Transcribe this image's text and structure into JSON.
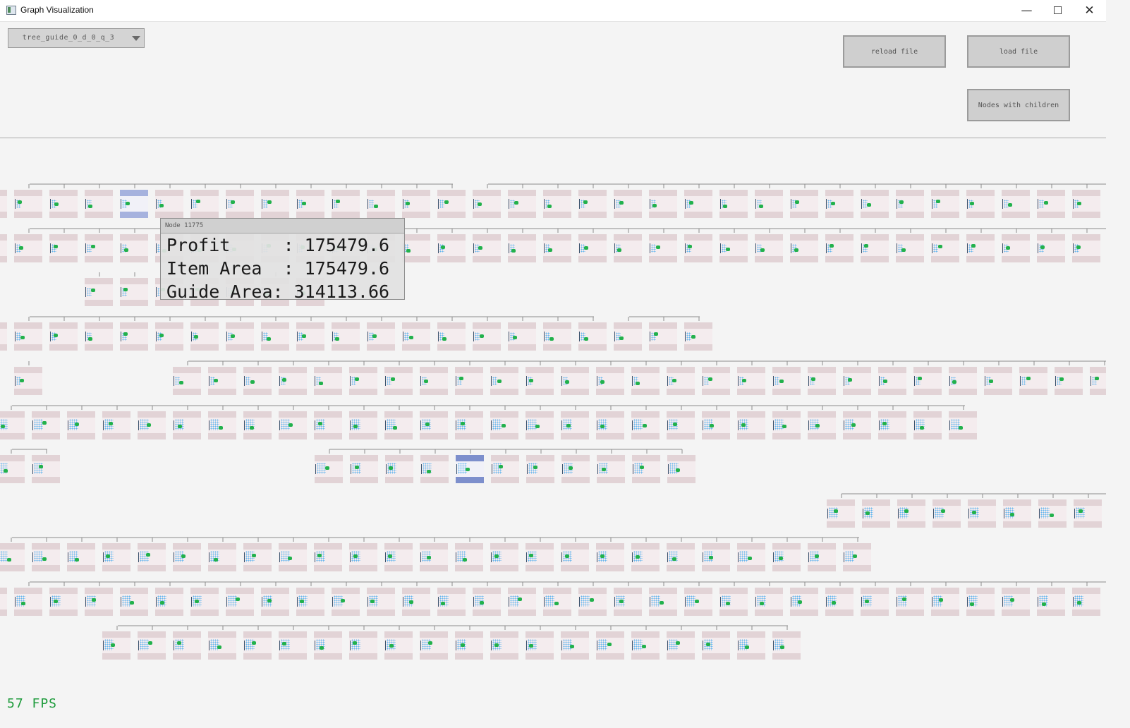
{
  "window": {
    "title": "Graph Visualization",
    "minimize": "—",
    "maximize": "☐",
    "close": "✕"
  },
  "toolbar": {
    "dropdown_value": "tree_guide_0_d_0_q_3",
    "reload_label": "reload file",
    "load_label": "load file",
    "children_label": "Nodes with children"
  },
  "tooltip": {
    "header": "Node 11775",
    "profit": "Profit     : 175479.6",
    "item_area": "Item Area  : 175479.6",
    "guide_area": "Guide Area: 314113.66"
  },
  "status": {
    "fps": "57 FPS"
  },
  "colors": {
    "node_band": "#e2d3d6",
    "node_selected_light": "#a6b2de",
    "node_selected_dark": "#7d8fcc",
    "item_blue": "#5db3ee",
    "item_green": "#22b14c",
    "fps_green": "#1d9b3b"
  }
}
